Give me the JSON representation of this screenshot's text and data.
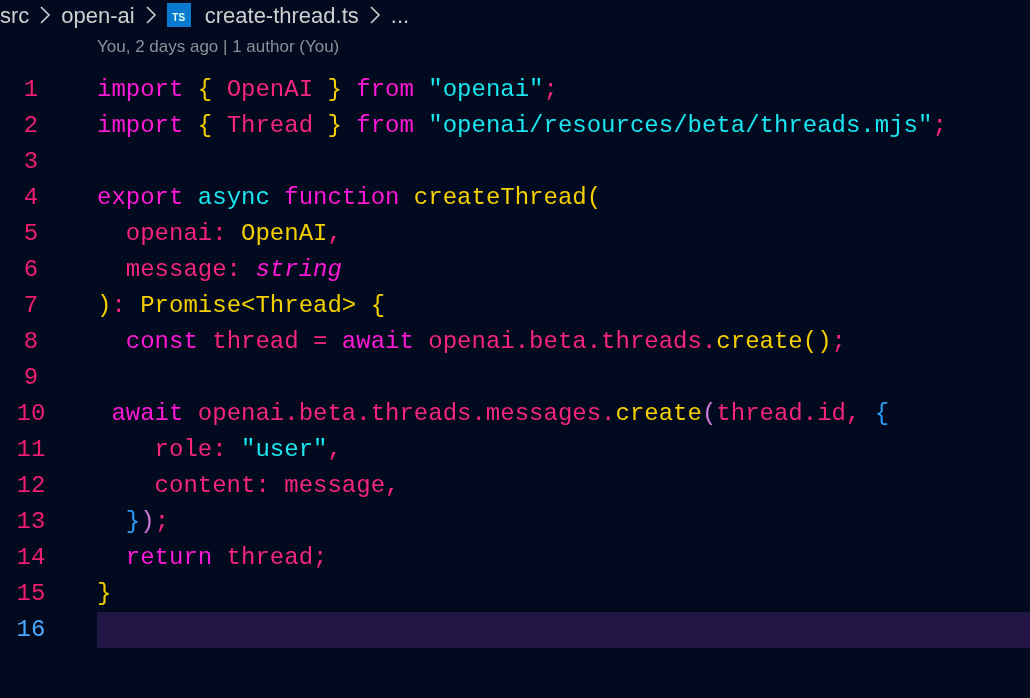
{
  "breadcrumb": [
    {
      "kind": "folder",
      "label": "src"
    },
    {
      "kind": "folder",
      "label": "open-ai"
    },
    {
      "kind": "file",
      "icon_label": "TS",
      "label": "create-thread.ts"
    },
    {
      "kind": "more",
      "label": "..."
    }
  ],
  "blame": "You, 2 days ago | 1 author (You)",
  "lines": [
    {
      "number": "1",
      "current": false,
      "tokens": [
        {
          "text": "import",
          "color": "#ff19d6"
        },
        {
          "text": " { ",
          "color": "#f5d000"
        },
        {
          "text": "OpenAI",
          "color": "#f5257a"
        },
        {
          "text": " } ",
          "color": "#f5d000"
        },
        {
          "text": "from",
          "color": "#ff19d6"
        },
        {
          "text": " \"openai\"",
          "color": "#19e6f0"
        },
        {
          "text": ";",
          "color": "#f5257a"
        }
      ]
    },
    {
      "number": "2",
      "current": false,
      "tokens": [
        {
          "text": "import",
          "color": "#ff19d6"
        },
        {
          "text": " { ",
          "color": "#f5d000"
        },
        {
          "text": "Thread",
          "color": "#f5257a"
        },
        {
          "text": " } ",
          "color": "#f5d000"
        },
        {
          "text": "from",
          "color": "#ff19d6"
        },
        {
          "text": " \"openai/resources/beta/threads.mjs\"",
          "color": "#19e6f0"
        },
        {
          "text": ";",
          "color": "#f5257a"
        }
      ]
    },
    {
      "number": "3",
      "current": false
    },
    {
      "number": "4",
      "current": false,
      "tokens": [
        {
          "text": "export",
          "color": "#ff19d6"
        },
        {
          "text": " async",
          "color": "#19e6f0"
        },
        {
          "text": " function",
          "color": "#ff19d6"
        },
        {
          "text": " createThread(",
          "color": "#f5d000"
        }
      ]
    },
    {
      "number": "5",
      "current": false,
      "tokens": [
        {
          "text": "  openai: ",
          "color": "#f5257a"
        },
        {
          "text": "OpenAI",
          "color": "#f5d000"
        },
        {
          "text": ",",
          "color": "#f5257a"
        }
      ]
    },
    {
      "number": "6",
      "current": false,
      "tokens": [
        {
          "text": "  message: ",
          "color": "#f5257a"
        },
        {
          "text": "string",
          "color": "#ff19d6",
          "italic": true
        }
      ]
    },
    {
      "number": "7",
      "current": false,
      "tokens": [
        {
          "text": ")",
          "color": "#f5d000"
        },
        {
          "text": ": ",
          "color": "#f5257a"
        },
        {
          "text": "Promise<Thread> {",
          "color": "#f5d000"
        }
      ]
    },
    {
      "number": "8",
      "current": false,
      "tokens": [
        {
          "text": "  const",
          "color": "#ff19d6"
        },
        {
          "text": " thread = ",
          "color": "#f5257a"
        },
        {
          "text": "await",
          "color": "#ff19d6"
        },
        {
          "text": " openai.beta.threads.",
          "color": "#f5257a"
        },
        {
          "text": "create()",
          "color": "#f5d000"
        },
        {
          "text": ";",
          "color": "#f5257a"
        }
      ]
    },
    {
      "number": "9",
      "current": false
    },
    {
      "number": "10",
      "current": false,
      "tokens": [
        {
          "text": " await",
          "color": "#ff19d6"
        },
        {
          "text": " openai.beta.threads.messages.",
          "color": "#f5257a"
        },
        {
          "text": "create",
          "color": "#f5d000"
        },
        {
          "text": "(",
          "color": "#d07ad8"
        },
        {
          "text": "thread.id, ",
          "color": "#f5257a"
        },
        {
          "text": "{",
          "color": "#2a9df4"
        }
      ]
    },
    {
      "number": "11",
      "current": false,
      "tokens": [
        {
          "text": "    role: ",
          "color": "#f5257a"
        },
        {
          "text": "\"user\"",
          "color": "#19e6f0"
        },
        {
          "text": ",",
          "color": "#f5257a"
        }
      ]
    },
    {
      "number": "12",
      "current": false,
      "tokens": [
        {
          "text": "    content: message,",
          "color": "#f5257a"
        }
      ]
    },
    {
      "number": "13",
      "current": false,
      "tokens": [
        {
          "text": "  }",
          "color": "#2a9df4"
        },
        {
          "text": ")",
          "color": "#d07ad8"
        },
        {
          "text": ";",
          "color": "#f5257a"
        }
      ]
    },
    {
      "number": "14",
      "current": false,
      "tokens": [
        {
          "text": "  return",
          "color": "#ff19d6"
        },
        {
          "text": " thread;",
          "color": "#f5257a"
        }
      ]
    },
    {
      "number": "15",
      "current": false,
      "tokens": [
        {
          "text": "}",
          "color": "#f5d000"
        }
      ]
    },
    {
      "number": "16",
      "current": true
    }
  ]
}
